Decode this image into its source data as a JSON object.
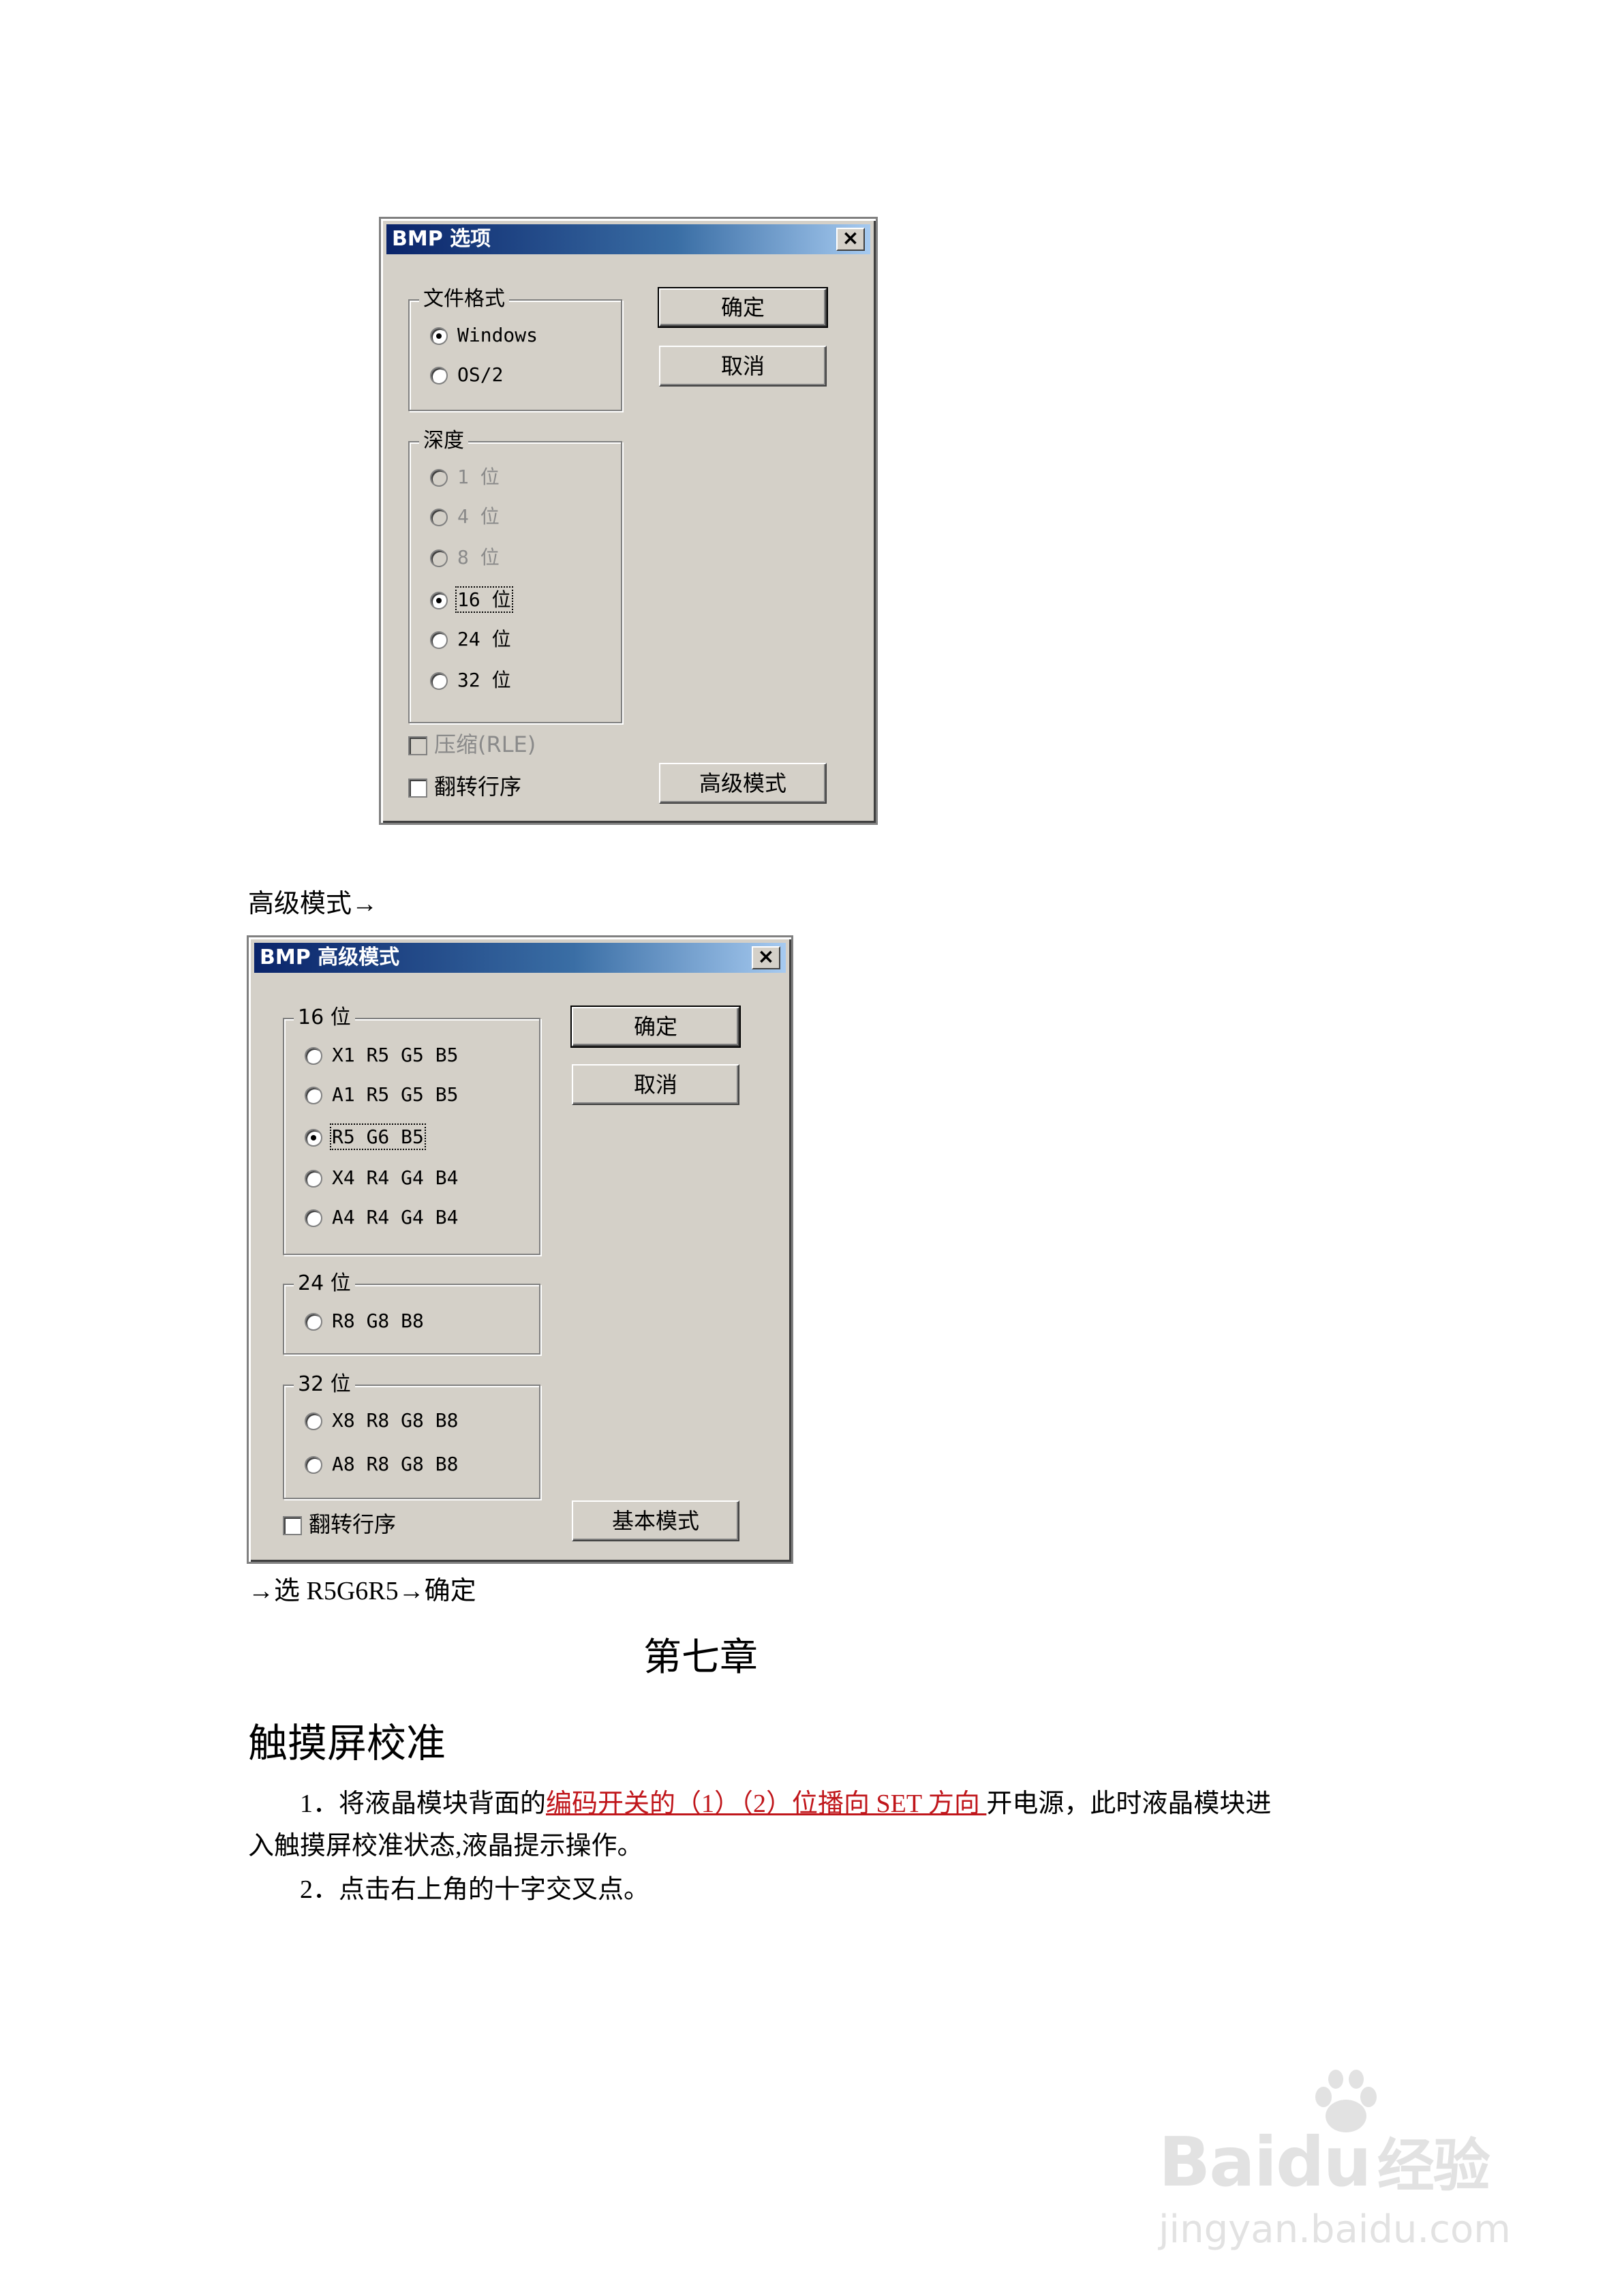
{
  "dialog1": {
    "title": "BMP 选项",
    "close": "×",
    "file_format": {
      "label": "文件格式",
      "options": [
        "Windows",
        "OS/2"
      ],
      "selected": "Windows"
    },
    "depth": {
      "label": "深度",
      "options": [
        "1 位",
        "4 位",
        "8 位",
        "16 位",
        "24 位",
        "32 位"
      ],
      "selected": "16 位",
      "disabled": [
        "1 位",
        "4 位",
        "8 位"
      ]
    },
    "compress_label": "压缩(RLE)",
    "flip_label": "翻转行序",
    "ok": "确定",
    "cancel": "取消",
    "advanced": "高级模式"
  },
  "caption1": "高级模式→",
  "dialog2": {
    "title": "BMP 高级模式",
    "close": "×",
    "group16": {
      "label": "16 位",
      "options": [
        "X1 R5 G5 B5",
        "A1 R5 G5 B5",
        "R5 G6 B5",
        "X4 R4 G4 B4",
        "A4 R4 G4 B4"
      ],
      "selected": "R5 G6 B5"
    },
    "group24": {
      "label": "24 位",
      "options": [
        "R8 G8 B8"
      ]
    },
    "group32": {
      "label": "32 位",
      "options": [
        "X8 R8 G8 B8",
        "A8 R8 G8 B8"
      ]
    },
    "flip_label": "翻转行序",
    "ok": "确定",
    "cancel": "取消",
    "basic": "基本模式"
  },
  "caption2": "→选 R5G6R5→确定",
  "chapter": "第七章",
  "heading": "触摸屏校准",
  "step1": {
    "prefix": "1．将液晶模块背面的",
    "highlight": "编码开关的（1）（2）位播向 SET 方向 ",
    "suffix": "开电源，此时液晶模块进",
    "line2": "入触摸屏校准状态,液晶提示操作。"
  },
  "step2": "2．点击右上角的十字交叉点。",
  "watermark": {
    "brand": "Baidu",
    "cn": "经验",
    "url": "jingyan.baidu.com"
  }
}
